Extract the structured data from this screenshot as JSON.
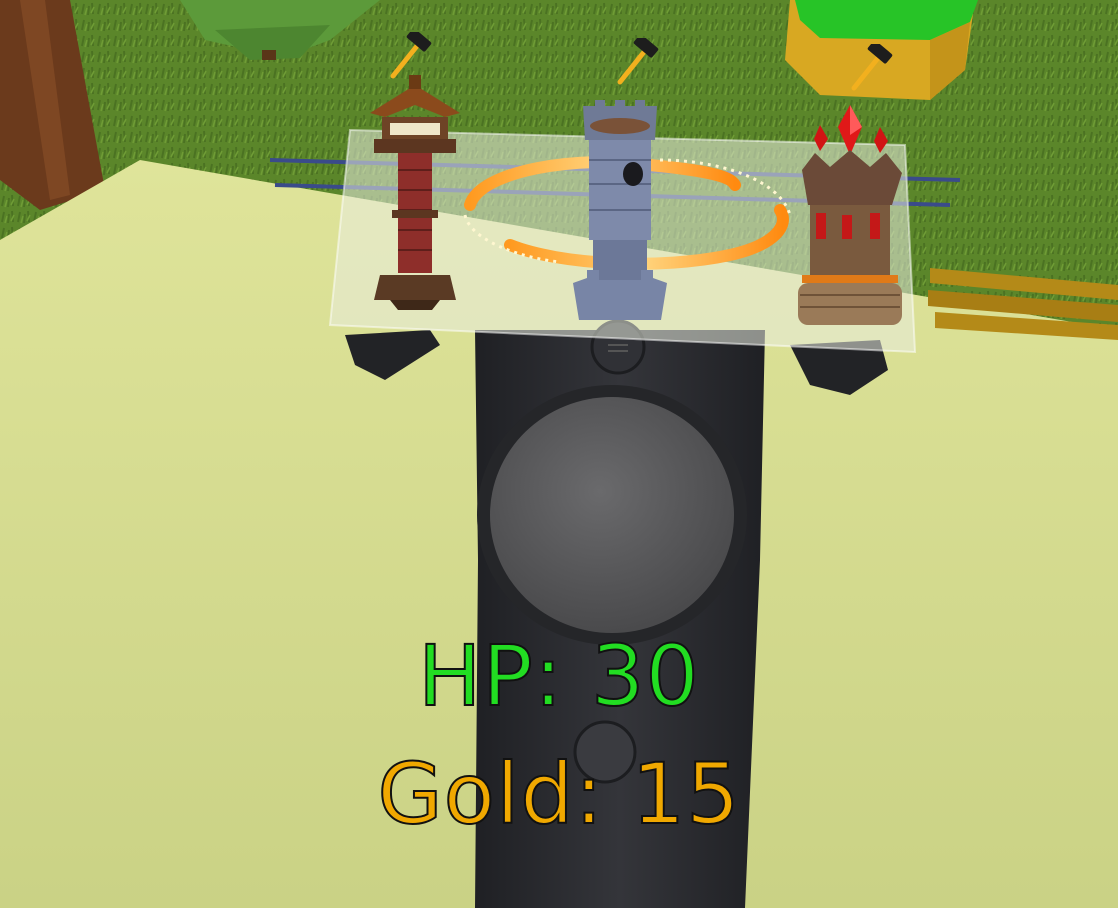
{
  "hud": {
    "hp_text": "HP: 30",
    "gold_text": "Gold: 15",
    "hp_color": "#22dd22",
    "gold_color": "#f0a800"
  },
  "tower_menu": {
    "towers": [
      {
        "name": "pagoda-tower",
        "icon": "hammer-icon"
      },
      {
        "name": "stone-tower",
        "icon": "hammer-icon",
        "selected": true
      },
      {
        "name": "crystal-tower",
        "icon": "hammer-icon"
      }
    ]
  },
  "colors": {
    "ground": "#d3db8c",
    "grass": "#5f8a2c",
    "controller": "#2e2f33",
    "trackpad": "#58585a",
    "hammer_handle": "#f2b01e"
  }
}
